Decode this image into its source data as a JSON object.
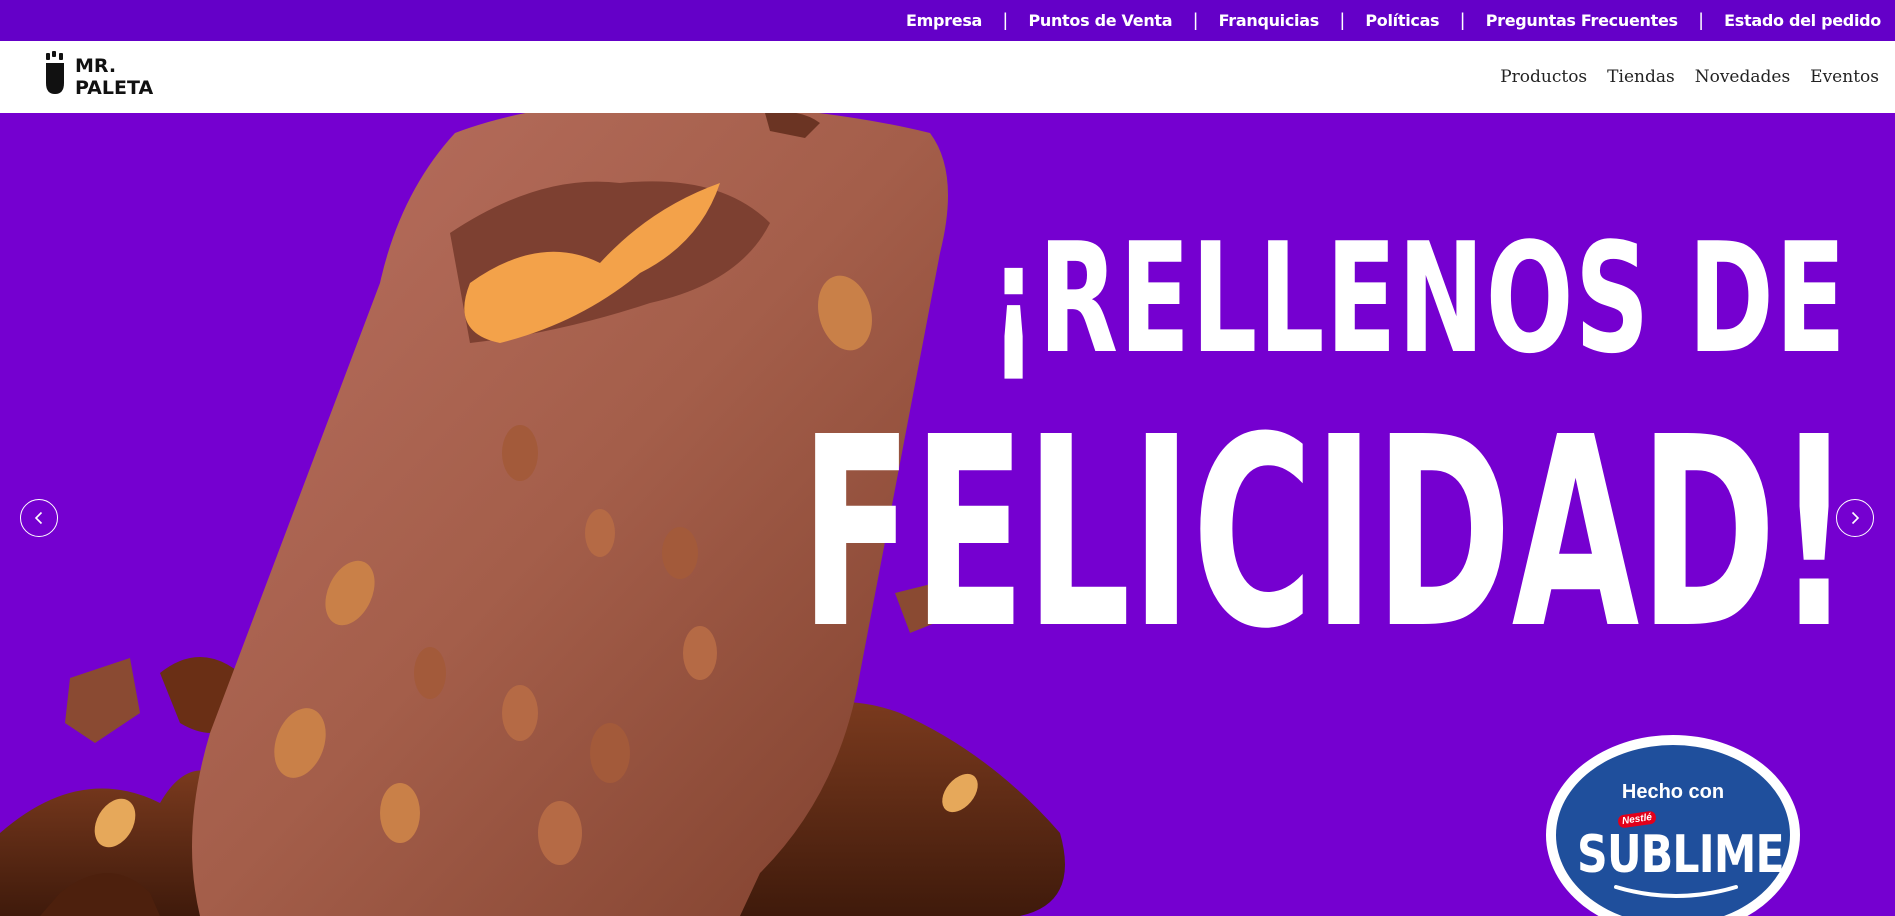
{
  "topbar": {
    "links": [
      "Empresa",
      "Puntos de Venta",
      "Franquicias",
      "Políticas",
      "Preguntas Frecuentes",
      "Estado del pedido"
    ],
    "separator": "|"
  },
  "header": {
    "logo_line1": "MR.",
    "logo_line2": "PALETA",
    "nav": [
      "Productos",
      "Tiendas",
      "Novedades",
      "Eventos"
    ]
  },
  "hero": {
    "headline_line1": "¡RELLENOS DE",
    "headline_line2": "FELICIDAD!",
    "badge_top": "Hecho con",
    "badge_tag": "Nestlé",
    "badge_brand": "SUBLIME"
  },
  "carousel": {
    "prev_icon": "chevron-left-icon",
    "next_icon": "chevron-right-icon"
  },
  "colors": {
    "topbar_bg": "#6400c8",
    "hero_bg": "#7500d0",
    "badge_blue": "#1f4f9c",
    "chocolate": "#8a4a32"
  }
}
